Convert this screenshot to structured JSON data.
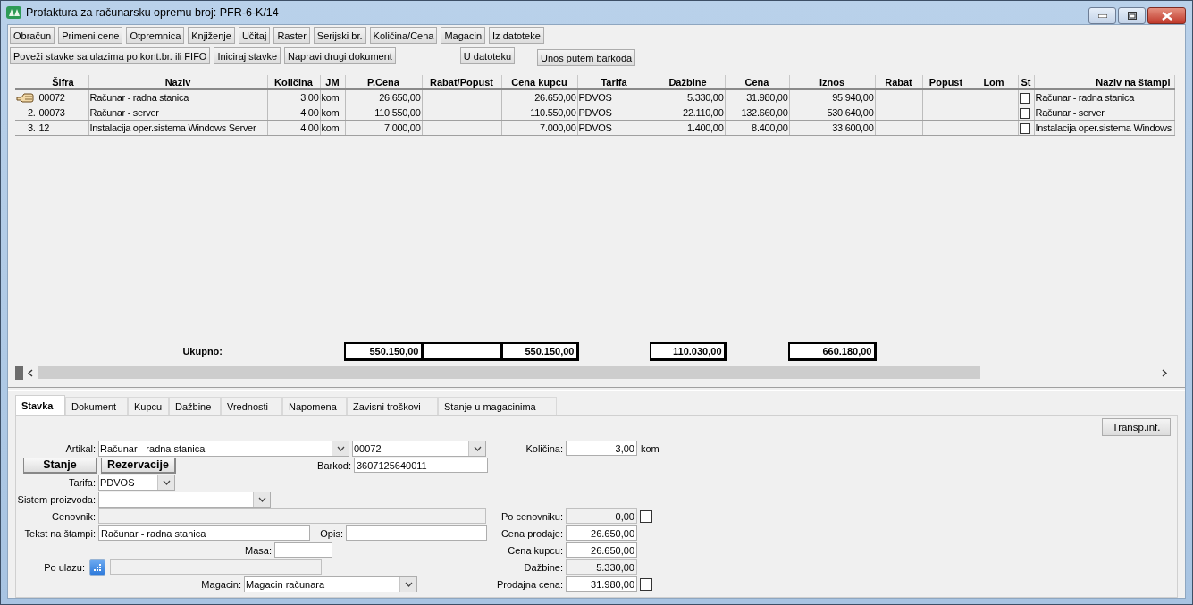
{
  "window": {
    "title": "Profaktura za računarsku opremu broj: PFR-6-K/14"
  },
  "toolbar_rows": [
    [
      {
        "label": "Obračun"
      },
      {
        "label": "Primeni cene"
      },
      {
        "label": "Otpremnica"
      },
      {
        "label": "Knjiženje"
      },
      {
        "label": "Učitaj"
      },
      {
        "label": "Raster"
      },
      {
        "label": "Serijski br."
      },
      {
        "label": "Količina/Cena"
      },
      {
        "label": "Magacin"
      },
      {
        "label": "Iz datoteke"
      }
    ],
    [
      {
        "label": "Poveži stavke sa ulazima po kont.br. ili FIFO"
      },
      {
        "label": "Iniciraj stavke"
      },
      {
        "label": "Napravi drugi dokument"
      },
      {
        "label": "U datoteku"
      },
      {
        "label": "Unos putem barkoda"
      }
    ]
  ],
  "table": {
    "columns": [
      "Šifra",
      "Naziv",
      "Količina",
      "JM",
      "P.Cena",
      "Rabat/Popust",
      "Cena kupcu",
      "Tarifa",
      "Dažbine",
      "Cena",
      "Iznos",
      "Rabat",
      "Popust",
      "Lom",
      "St",
      "Naziv na štampi"
    ],
    "rows": [
      {
        "current": true,
        "cells": [
          "00072",
          "Računar - radna stanica",
          "3,00",
          "kom",
          "26.650,00",
          null,
          "26.650,00",
          "PDVOS",
          "5.330,00",
          "31.980,00",
          "95.940,00",
          null,
          null,
          null
        ],
        "st_checked": false,
        "naziv_na_stampi": "Računar - radna stanica"
      },
      {
        "current": false,
        "number": "2.",
        "cells": [
          "00073",
          "Računar - server",
          "4,00",
          "kom",
          "110.550,00",
          null,
          "110.550,00",
          "PDVOS",
          "22.110,00",
          "132.660,00",
          "530.640,00",
          null,
          null,
          null
        ],
        "st_checked": false,
        "naziv_na_stampi": "Računar - server"
      },
      {
        "current": false,
        "number": "3.",
        "cells": [
          "12",
          "Instalacija oper.sistema Windows Server",
          "4,00",
          "kom",
          "7.000,00",
          null,
          "7.000,00",
          "PDVOS",
          "1.400,00",
          "8.400,00",
          "33.600,00",
          null,
          null,
          null
        ],
        "st_checked": false,
        "naziv_na_stampi": "Instalacija oper.sistema Windows"
      }
    ],
    "totals": {
      "label": "Ukupno:",
      "p_cena": "550.150,00",
      "cena_kupcu": "550.150,00",
      "dazbine": "110.030,00",
      "iznos": "660.180,00"
    }
  },
  "tabs": [
    {
      "label": "Stavka",
      "selected": true
    },
    {
      "label": "Dokument",
      "selected": false
    },
    {
      "label": "Kupcu",
      "selected": false
    },
    {
      "label": "Dažbine",
      "selected": false
    },
    {
      "label": "Vrednosti",
      "selected": false
    },
    {
      "label": "Napomena",
      "selected": false
    },
    {
      "label": "Zavisni troškovi",
      "selected": false
    },
    {
      "label": "Stanje u magacinima",
      "selected": false
    }
  ],
  "transp_button": "Transp.inf.",
  "form": {
    "artikal": {
      "label": "Artikal:",
      "value": "Računar - radna stanica",
      "code": "00072"
    },
    "buttons": [
      "Stanje",
      "Rezervacije"
    ],
    "barkod": {
      "label": "Barkod:",
      "value": "3607125640011"
    },
    "tarifa": {
      "label": "Tarifa:",
      "value": "PDVOS"
    },
    "sistem_proizvoda": {
      "label": "Sistem proizvoda:"
    },
    "cenovnik": {
      "label": "Cenovnik:",
      "disabled": true
    },
    "tekst_na_stampi": {
      "label": "Tekst na štampi:",
      "value": "Računar - radna stanica"
    },
    "opis": {
      "label": "Opis:"
    },
    "masa": {
      "label": "Masa:"
    },
    "po_ulazu": {
      "label": "Po ulazu:",
      "disabled": true
    },
    "magacin": {
      "label": "Magacin:",
      "value": "Magacin računara"
    },
    "kolicina": {
      "label": "Količina:",
      "value": "3,00",
      "unit": "kom"
    },
    "po_cenovniku": {
      "label": "Po cenovniku:",
      "value": "0,00",
      "disabled": true,
      "checked": false
    },
    "cena_prodaje": {
      "label": "Cena prodaje:",
      "value": "26.650,00"
    },
    "cena_kupcu": {
      "label": "Cena kupcu:",
      "value": "26.650,00"
    },
    "dazbine": {
      "label": "Dažbine:",
      "value": "5.330,00",
      "disabled": true
    },
    "prodajna_cena": {
      "label": "Prodajna cena:",
      "value": "31.980,00",
      "checked": false
    }
  }
}
